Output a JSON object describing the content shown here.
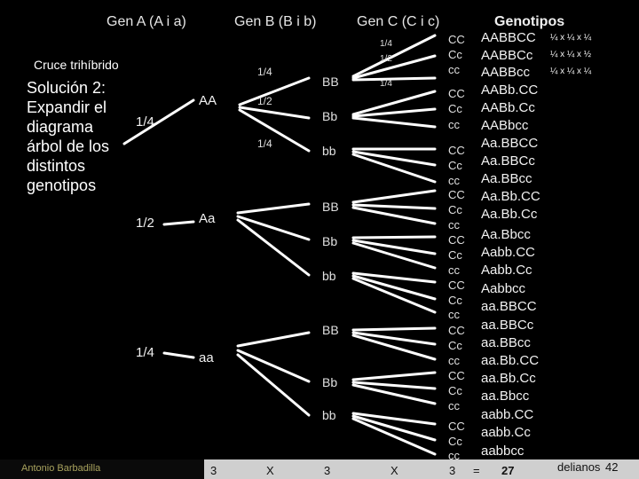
{
  "headers": {
    "gen_a": "Gen A (A i a)",
    "gen_b": "Gen B (B i b)",
    "gen_c": "Gen C (C i c)",
    "genotipos": "Genotipos"
  },
  "cruce": "Cruce trihíbrido",
  "solucion": "Solución 2: Expandir el diagrama árbol de los distintos genotipos",
  "gen_a_branches": [
    {
      "label": "AA",
      "prob": "1/4"
    },
    {
      "label": "Aa",
      "prob": "1/2"
    },
    {
      "label": "aa",
      "prob": "1/4"
    }
  ],
  "gen_b_probs": [
    "1/4",
    "1/2",
    "1/4"
  ],
  "gen_b_labels": [
    "BB",
    "Bb",
    "bb",
    "BB",
    "Bb",
    "bb",
    "BB",
    "Bb",
    "bb"
  ],
  "gen_c_probs": [
    "1/4",
    "1/2",
    "1/4"
  ],
  "gen_c_labels": [
    "CC",
    "Cc",
    "cc",
    "CC",
    "Cc",
    "cc",
    "CC",
    "Cc",
    "cc",
    "CC",
    "Cc",
    "cc",
    "CC",
    "Cc",
    "cc",
    "CC",
    "Cc",
    "cc",
    "CC",
    "Cc",
    "cc",
    "CC",
    "Cc",
    "cc",
    "CC",
    "Cc",
    "cc"
  ],
  "genotipos": [
    "AABBCC",
    "AABBCc",
    "AABBcc",
    "AABb.CC",
    "AABb.Cc",
    "AABbcc",
    "Aa.BBCC",
    "Aa.BBCc",
    "Aa.BBcc",
    "Aa.Bb.CC",
    "Aa.Bb.Cc",
    "Aa.Bbcc",
    "Aabb.CC",
    "Aabb.Cc",
    "Aabbcc",
    "aa.BBCC",
    "aa.BBCc",
    "aa.BBcc",
    "aa.Bb.CC",
    "aa.Bb.Cc",
    "aa.Bbcc",
    "aabb.CC",
    "aabb.Cc",
    "aabbcc"
  ],
  "prob_rows": [
    "¼ x ¼ x ¼",
    "¼ x ¼ x ½",
    "¼ x ¼ x ¼"
  ],
  "footer": {
    "credit": "Antonio Barbadilla",
    "n1": "3",
    "x1": "X",
    "n2": "3",
    "x2": "X",
    "n3": "3",
    "eq": "=",
    "result": "27",
    "tail": "delianos",
    "page": "42"
  },
  "colors": {
    "background": "#000000",
    "lines": "#ffffff",
    "bottom_band": "#cfcfcf",
    "credit": "#a9a35e"
  }
}
